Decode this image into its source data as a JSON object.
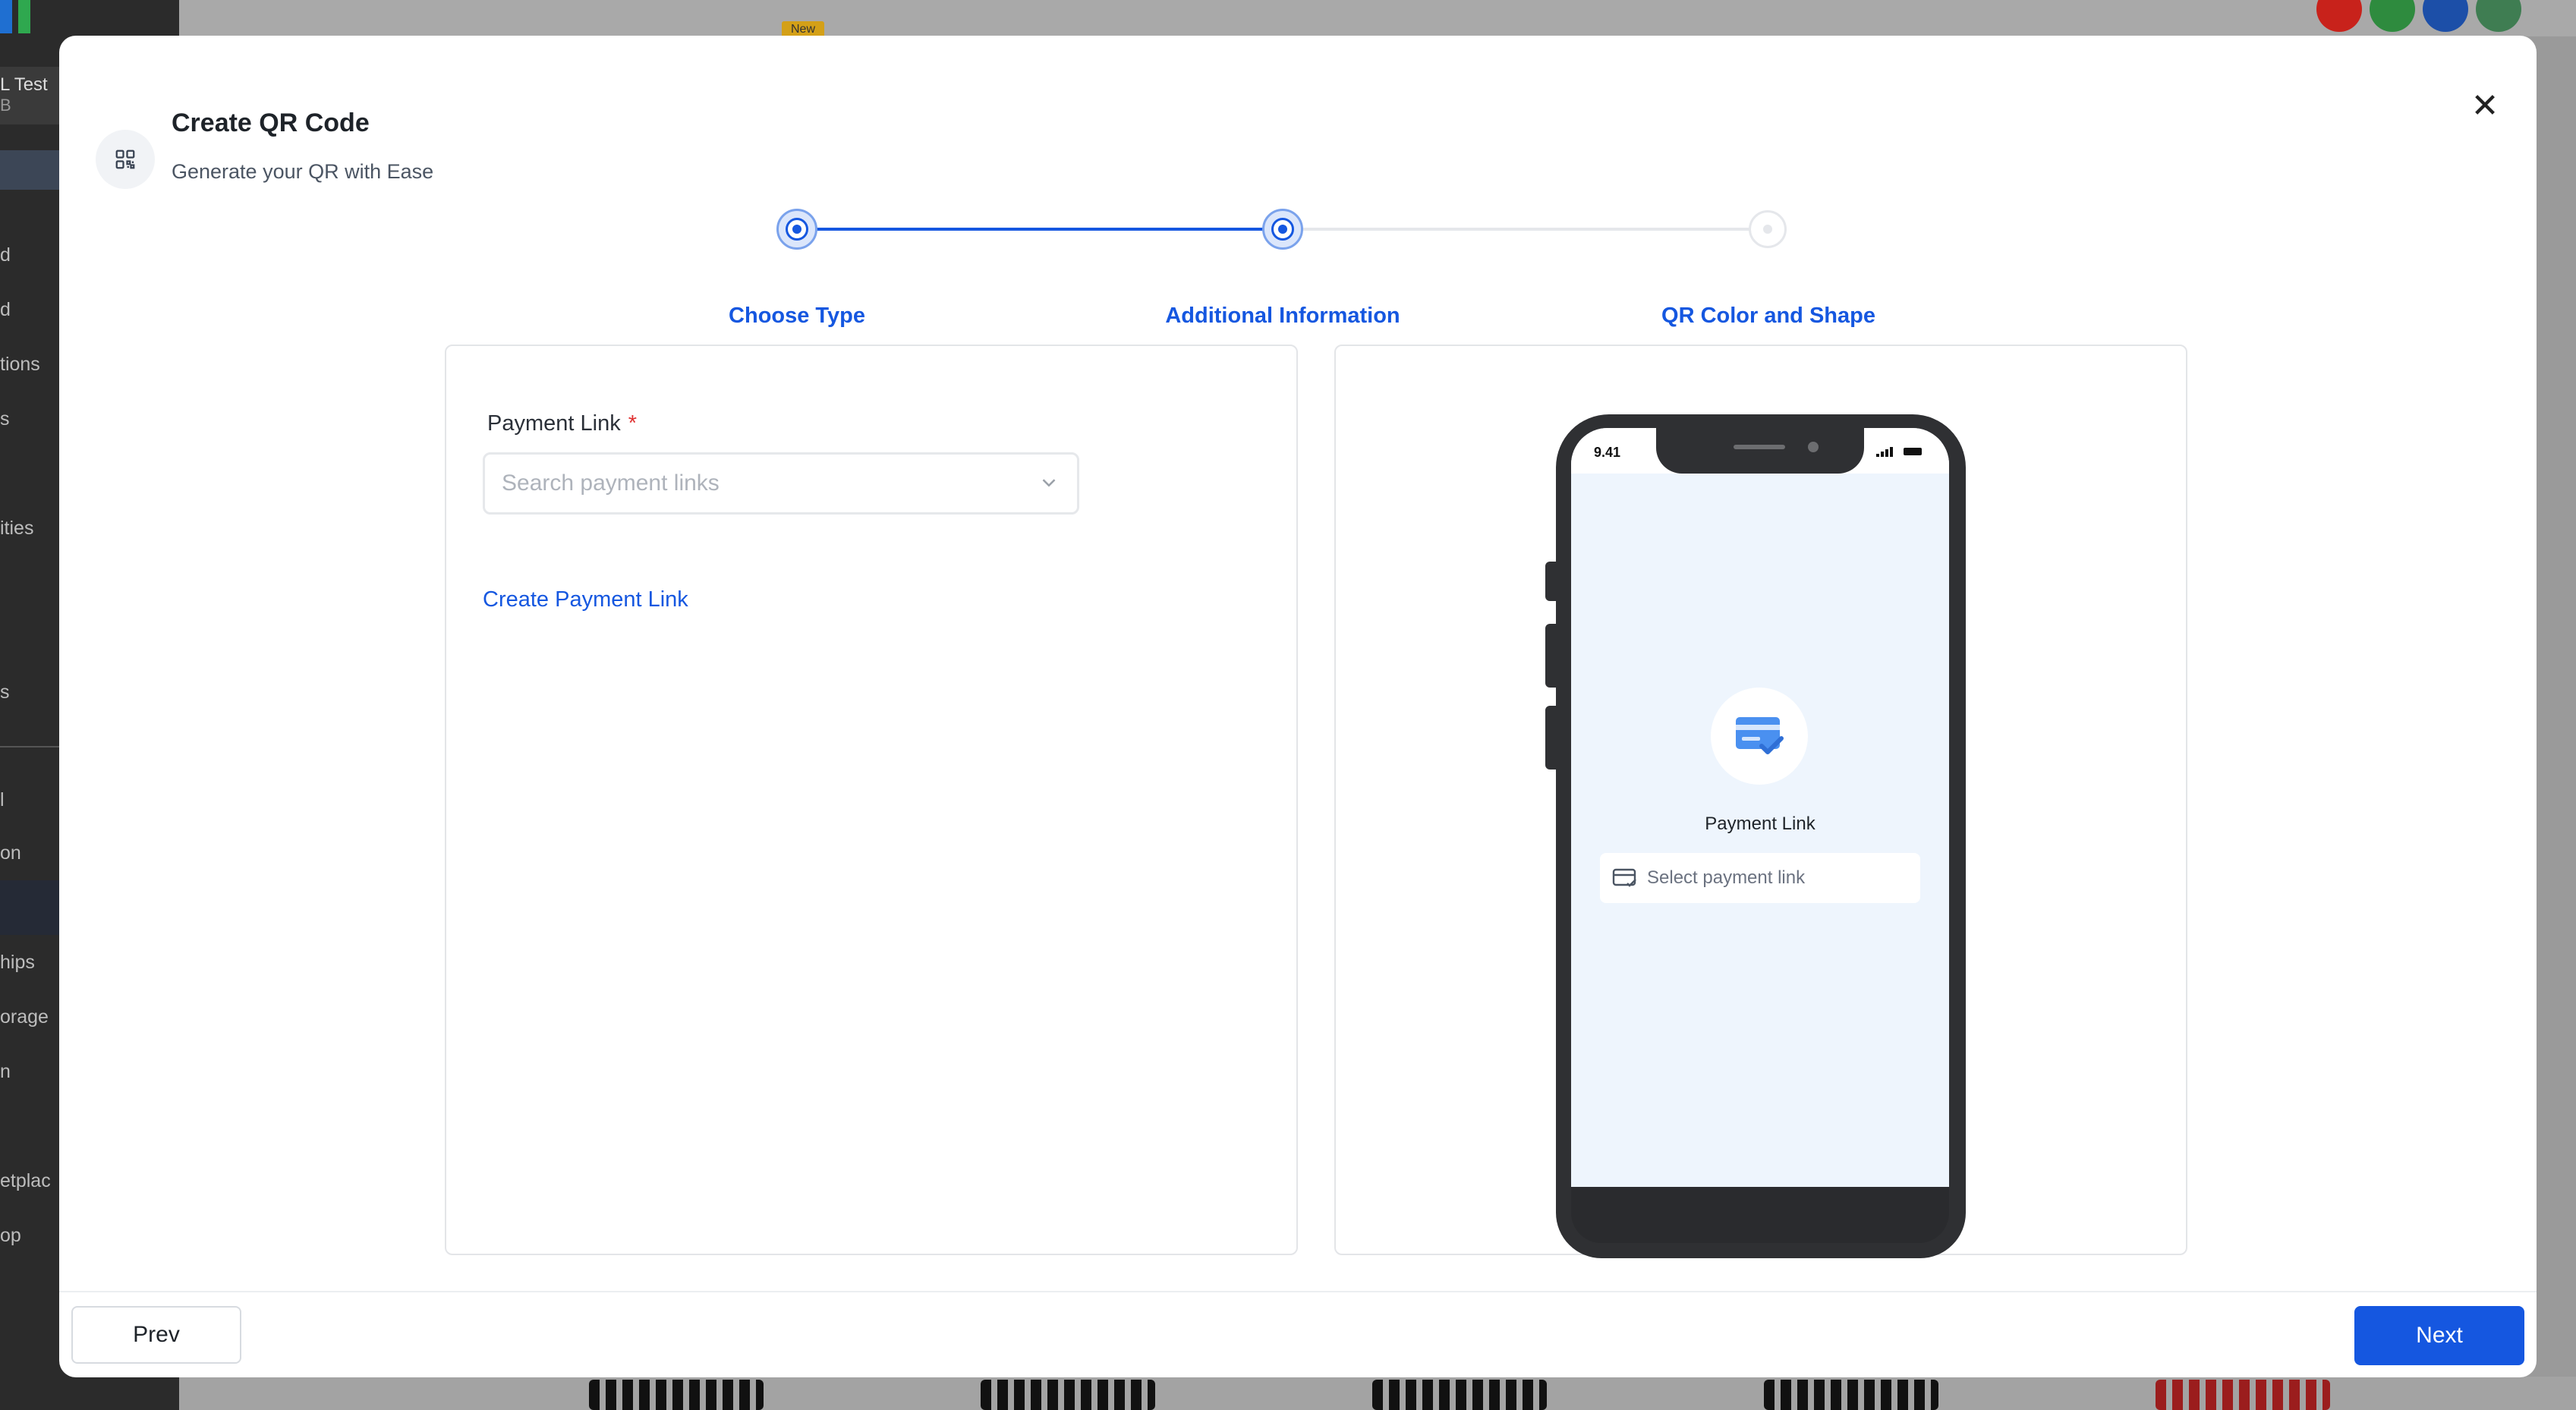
{
  "background": {
    "badge_new": "New",
    "account_name": "L Test",
    "account_sub": "B",
    "nav_fragments": [
      "d",
      "d",
      "tions",
      "s",
      "ities",
      "s",
      "l",
      "on",
      "hips",
      "orage",
      "n",
      "etplac",
      "op"
    ]
  },
  "modal": {
    "title": "Create QR Code",
    "subtitle": "Generate your QR with Ease",
    "close_symbol": "✕",
    "header_icon": "qr-code-icon"
  },
  "stepper": {
    "steps": [
      {
        "label": "Choose Type",
        "state": "completed"
      },
      {
        "label": "Additional Information",
        "state": "current"
      },
      {
        "label": "QR Color and Shape",
        "state": "upcoming"
      }
    ]
  },
  "form": {
    "payment_link_label": "Payment Link",
    "required_mark": "*",
    "search_placeholder": "Search payment links",
    "create_link_text": "Create Payment Link"
  },
  "preview": {
    "status_time": "9.41",
    "title": "Payment Link",
    "select_text": "Select payment link",
    "icon": "payment-card-check-icon"
  },
  "footer": {
    "prev_label": "Prev",
    "next_label": "Next"
  },
  "colors": {
    "primary": "#1557e0",
    "required": "#e03131",
    "preview_bg": "#eef5fd"
  }
}
